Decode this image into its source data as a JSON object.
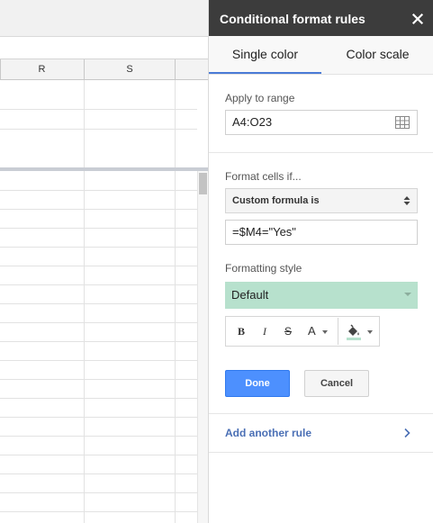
{
  "sheet": {
    "columns": [
      {
        "label": ""
      },
      {
        "label": "R"
      },
      {
        "label": "S"
      },
      {
        "label": ""
      }
    ]
  },
  "panel": {
    "title": "Conditional format rules",
    "tabs": [
      {
        "label": "Single color",
        "active": true
      },
      {
        "label": "Color scale",
        "active": false
      }
    ],
    "range": {
      "label": "Apply to range",
      "value": "A4:O23"
    },
    "condition": {
      "label": "Format cells if...",
      "selected": "Custom formula is",
      "formula": "=$M4=\"Yes\""
    },
    "style": {
      "label": "Formatting style",
      "preset": "Default",
      "preview_color": "#b7e1cd"
    },
    "toolbar": {
      "bold": "B",
      "italic": "I",
      "strikethrough": "S",
      "text_color": "A"
    },
    "buttons": {
      "done": "Done",
      "cancel": "Cancel"
    },
    "add_rule": "Add another rule"
  },
  "colors": {
    "header_bg": "#3c3c3c",
    "accent": "#4a7bd6",
    "done_bg": "#4d90fe",
    "link": "#4a6fb5"
  }
}
